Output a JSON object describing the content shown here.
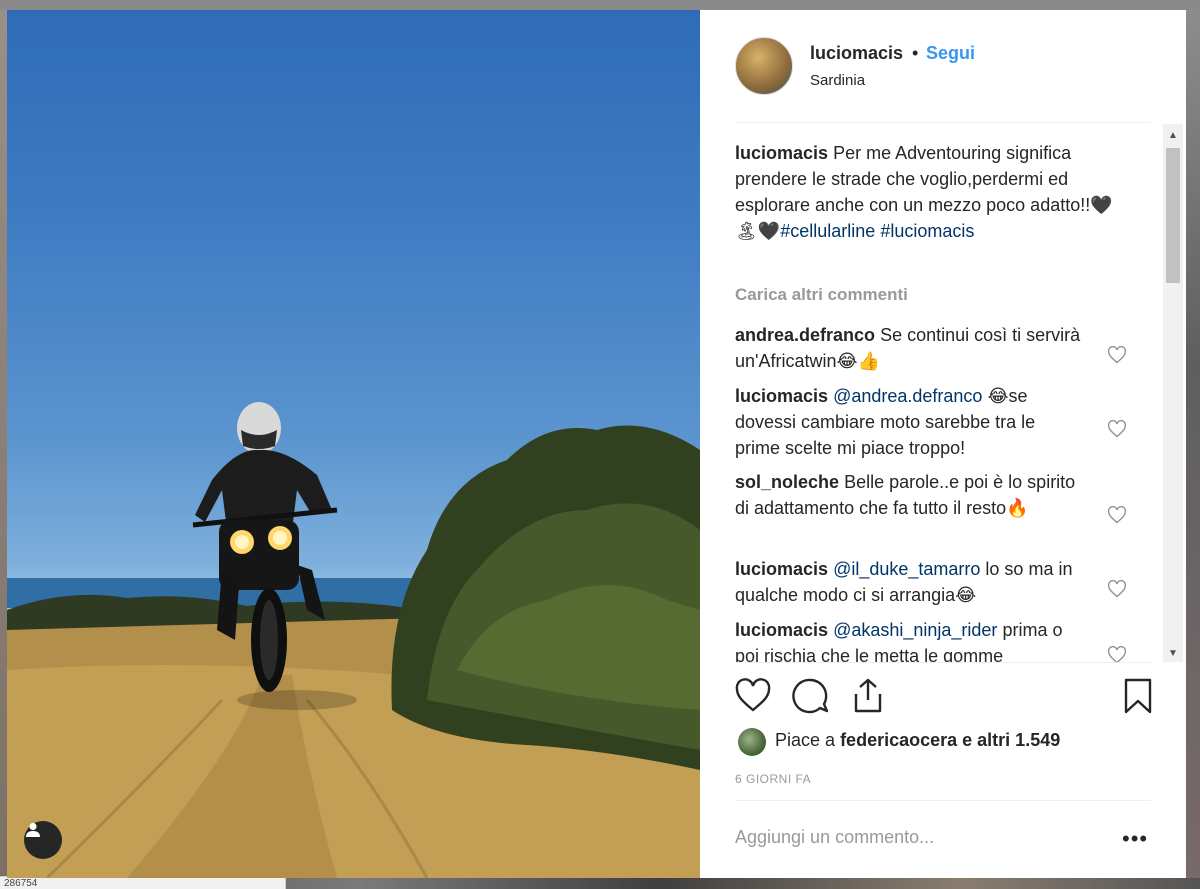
{
  "post": {
    "username": "luciomacis",
    "dot": "•",
    "follow_label": "Segui",
    "location": "Sardinia",
    "caption_user": "luciomacis",
    "caption_text": "Per me Adventouring significa prendere le strade che voglio,perdermi ed esplorare anche con un mezzo poco adatto!!🖤🏝🖤",
    "caption_tag1": "#cellularline",
    "caption_tag2": "#luciomacis",
    "load_more": "Carica altri commenti",
    "comments": [
      {
        "user": "andrea.defranco",
        "text": "Se continui così ti servirà un'Africatwin😂👍"
      },
      {
        "user": "luciomacis",
        "mention": "@andrea.defranco",
        "text": "😂se dovessi cambiare moto sarebbe tra le prime scelte mi piace troppo!"
      },
      {
        "user": "sol_noleche",
        "text": "Belle parole..e poi è lo spirito di adattamento che fa tutto il resto🔥"
      },
      {
        "user": "luciomacis",
        "mention": "@il_duke_tamarro",
        "text": "lo so ma in qualche modo ci si arrangia😂"
      },
      {
        "user": "luciomacis",
        "mention": "@akashi_ninja_rider",
        "text": "prima o poi rischia che le metta le gomme"
      }
    ],
    "likes_prefix": "Piace a",
    "likes_user": "federicaocera",
    "likes_suffix": "e altri 1.549",
    "time_ago": "6 GIORNI FA",
    "add_comment_placeholder": "Aggiungi un commento...",
    "more_label": "•••"
  },
  "url_peek": "286754",
  "icons": [
    "heart-icon",
    "comment-icon",
    "share-icon",
    "bookmark-icon",
    "user-tag-icon",
    "more-options-icon"
  ],
  "colors": {
    "link": "#3897f0",
    "hashtag": "#003569",
    "muted": "#999999",
    "text": "#262626"
  }
}
